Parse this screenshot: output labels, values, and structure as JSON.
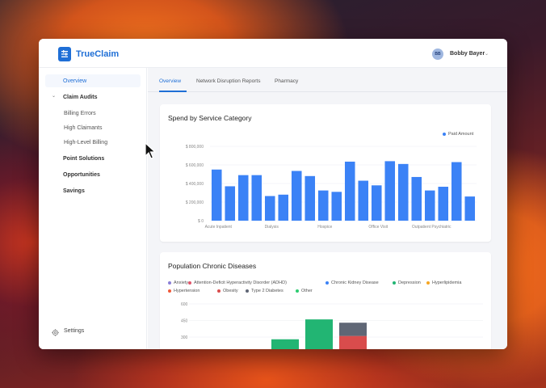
{
  "app": {
    "brand": "TrueClaim"
  },
  "user": {
    "initials": "BB",
    "name": "Bobby Bayer"
  },
  "sidebar": {
    "items": [
      {
        "label": "Overview"
      },
      {
        "label": "Claim Audits"
      },
      {
        "label": "Billing Errors"
      },
      {
        "label": "High Claimants"
      },
      {
        "label": "High-Level Billing"
      },
      {
        "label": "Point Solutions"
      },
      {
        "label": "Opportunities"
      },
      {
        "label": "Savings"
      }
    ],
    "settings_label": "Settings"
  },
  "tabs": [
    {
      "label": "Overview"
    },
    {
      "label": "Network Disruption Reports"
    },
    {
      "label": "Pharmacy"
    }
  ],
  "spend_card": {
    "chart_data": {
      "type": "bar",
      "title": "Spend by Service Category",
      "series": [
        {
          "name": "Paid Amount",
          "color": "#3b82f6",
          "values": [
            550000,
            370000,
            490000,
            490000,
            265000,
            280000,
            535000,
            480000,
            325000,
            310000,
            635000,
            430000,
            380000,
            640000,
            610000,
            470000,
            325000,
            365000,
            630000,
            260000
          ]
        }
      ],
      "xtick_labels": [
        "Acute Inpatient",
        "Dialysis",
        "Hospice",
        "Office Visit",
        "Outpatient Psychiatric"
      ],
      "xtick_positions": [
        0,
        4,
        8,
        12,
        16
      ],
      "ytick_labels": [
        "$ 800,000",
        "$ 600,000",
        "$ 400,000",
        "$ 200,000",
        "$ 0"
      ],
      "ytick_values": [
        800000,
        600000,
        400000,
        200000,
        0
      ],
      "ylim": [
        0,
        800000
      ],
      "legend": "top-right",
      "grid": true
    }
  },
  "disease_card": {
    "chart_data": {
      "type": "bar",
      "title": "Population Chronic Diseases",
      "legend_items": [
        {
          "name": "Anxiety",
          "color": "#8b7fd6"
        },
        {
          "name": "Attention-Deficit Hyperactivity Disorder (ADHD)",
          "color": "#e0566b"
        },
        {
          "name": "Chronic Kidney Disease",
          "color": "#3b82f6"
        },
        {
          "name": "Depression",
          "color": "#22b573"
        },
        {
          "name": "Hyperlipidemia",
          "color": "#f5a623"
        },
        {
          "name": "Hypertension",
          "color": "#f05a3a"
        },
        {
          "name": "Obesity",
          "color": "#d94c4c"
        },
        {
          "name": "Type 2 Diabetes",
          "color": "#5f6675"
        },
        {
          "name": "Other",
          "color": "#2ecc71"
        }
      ],
      "ytick_labels": [
        "600",
        "450",
        "300"
      ],
      "ytick_values": [
        600,
        450,
        300
      ],
      "ylim": [
        0,
        600
      ],
      "stacks": [
        {
          "segments": [
            {
              "name": "Depression",
              "value": 280
            }
          ]
        },
        {
          "segments": [
            {
              "name": "Depression",
              "value": 460
            }
          ]
        },
        {
          "segments": [
            {
              "name": "Obesity",
              "value": 310
            },
            {
              "name": "Type 2 Diabetes",
              "value": 120
            }
          ]
        }
      ],
      "legend": "top",
      "grid": true
    }
  }
}
